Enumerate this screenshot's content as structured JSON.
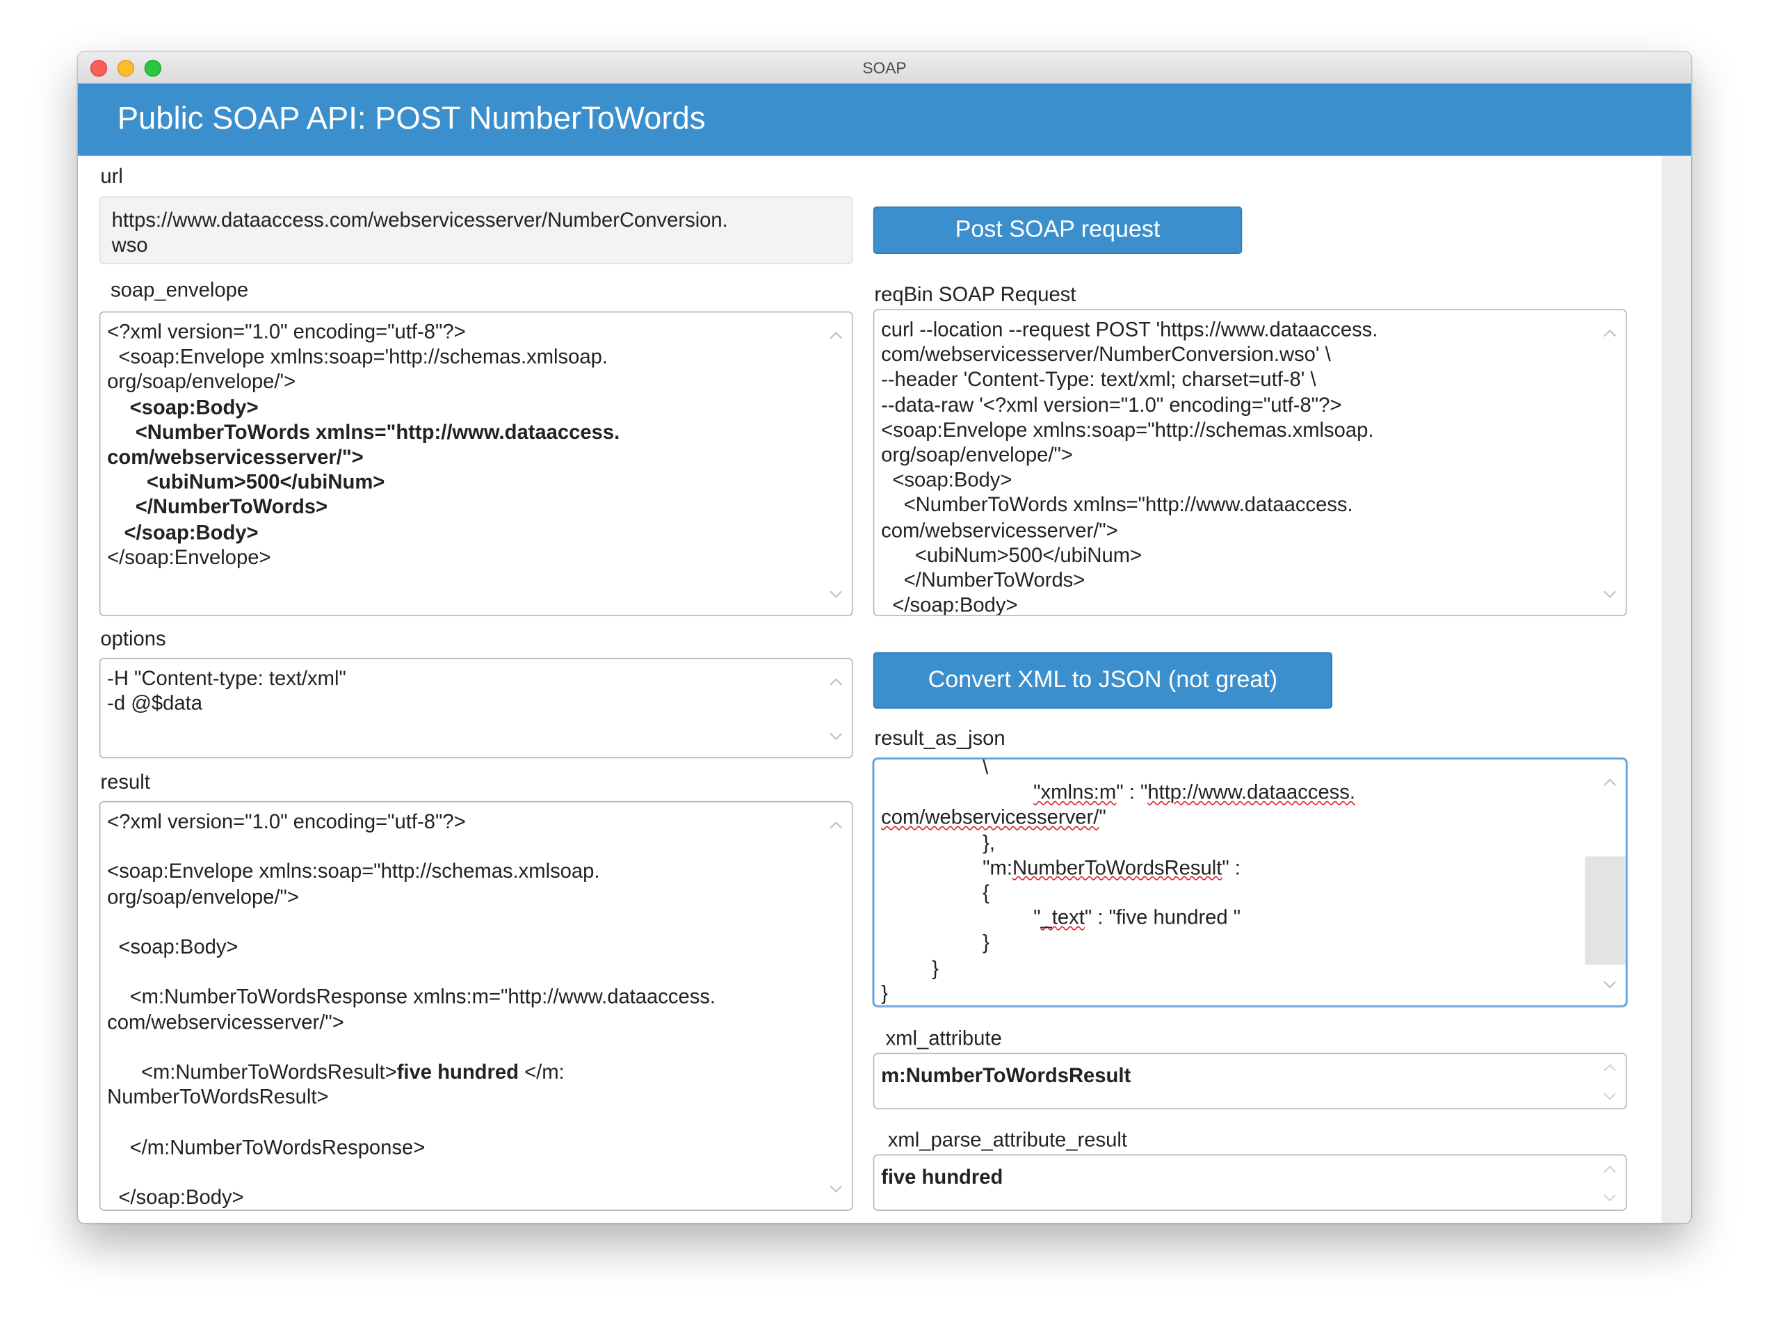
{
  "window": {
    "title": "SOAP"
  },
  "header": {
    "title": "Public SOAP API: POST NumberToWords"
  },
  "url": {
    "label": "url",
    "value": "https://www.dataaccess.com/webservicesserver/NumberConversion.wso",
    "line1": "https://www.dataaccess.com/webservicesserver/NumberConversion.",
    "line2": "wso"
  },
  "buttons": {
    "post": "Post SOAP request",
    "convert": "Convert XML to JSON (not great)"
  },
  "soap_envelope": {
    "label": "soap_envelope",
    "lines": [
      {
        "text": "<?xml version=\"1.0\" encoding=\"utf-8\"?>",
        "bold": false
      },
      {
        "text": "  <soap:Envelope xmlns:soap='http://schemas.xmlsoap.",
        "bold": false
      },
      {
        "text": "org/soap/envelope/'>",
        "bold": false
      },
      {
        "text": "    <soap:Body>",
        "bold": true
      },
      {
        "text": "     <NumberToWords xmlns=\"http://www.dataaccess.",
        "bold": true
      },
      {
        "text": "com/webservicesserver/\">",
        "bold": true
      },
      {
        "text": "       <ubiNum>500</ubiNum>",
        "bold": true
      },
      {
        "text": "     </NumberToWords>",
        "bold": true
      },
      {
        "text": "   </soap:Body>",
        "bold": true
      },
      {
        "text": "</soap:Envelope>",
        "bold": false
      }
    ]
  },
  "reqbin": {
    "label": "reqBin SOAP Request",
    "lines": [
      "curl --location --request POST 'https://www.dataaccess.",
      "com/webservicesserver/NumberConversion.wso' \\",
      "--header 'Content-Type: text/xml; charset=utf-8' \\",
      "--data-raw '<?xml version=\"1.0\" encoding=\"utf-8\"?>",
      "<soap:Envelope xmlns:soap=\"http://schemas.xmlsoap.",
      "org/soap/envelope/\">",
      "  <soap:Body>",
      "    <NumberToWords xmlns=\"http://www.dataaccess.",
      "com/webservicesserver/\">",
      "      <ubiNum>500</ubiNum>",
      "    </NumberToWords>",
      "  </soap:Body>"
    ]
  },
  "options": {
    "label": "options",
    "lines": [
      "-H \"Content-type: text/xml\"",
      "-d @$data"
    ]
  },
  "result": {
    "label": "result",
    "lines": [
      {
        "text": "<?xml version=\"1.0\" encoding=\"utf-8\"?>"
      },
      {
        "text": ""
      },
      {
        "text": "<soap:Envelope xmlns:soap=\"http://schemas.xmlsoap."
      },
      {
        "text": "org/soap/envelope/\">"
      },
      {
        "text": ""
      },
      {
        "text": "  <soap:Body>"
      },
      {
        "text": ""
      },
      {
        "text": "    <m:NumberToWordsResponse xmlns:m=\"http://www.dataaccess."
      },
      {
        "text": "com/webservicesserver/\">"
      },
      {
        "text": ""
      },
      {
        "text": "      <m:NumberToWordsResult>",
        "bold_tail": "five hundred",
        "tail": " </m:"
      },
      {
        "text": "NumberToWordsResult>"
      },
      {
        "text": ""
      },
      {
        "text": "    </m:NumberToWordsResponse>"
      },
      {
        "text": ""
      },
      {
        "text": "  </soap:Body>"
      }
    ]
  },
  "result_as_json": {
    "label": "result_as_json",
    "lines": [
      {
        "pre": "                  ",
        "text": "\\"
      },
      {
        "pre": "                           ",
        "sq": "\"xmlns:m",
        "text": "\" : \"",
        "sq2": "http://www.dataaccess.",
        "text2": ""
      },
      {
        "pre": "",
        "sq": "com/webservicesserver/",
        "text": "\""
      },
      {
        "pre": "                  ",
        "text": "},"
      },
      {
        "pre": "                  ",
        "text": "\"m:",
        "sq": "NumberToWordsResult",
        "text2": "\" :"
      },
      {
        "pre": "                  ",
        "text": "{"
      },
      {
        "pre": "                           ",
        "text": "\"",
        "sq": "_text",
        "text2": "\" : \"five hundred \""
      },
      {
        "pre": "                  ",
        "text": "}"
      },
      {
        "pre": "         ",
        "text": "}"
      },
      {
        "pre": "",
        "text": "}"
      }
    ]
  },
  "xml_attribute": {
    "label": "xml_attribute",
    "value": "m:NumberToWordsResult"
  },
  "xml_parse_attribute_result": {
    "label": "xml_parse_attribute_result",
    "value": "five hundred"
  }
}
